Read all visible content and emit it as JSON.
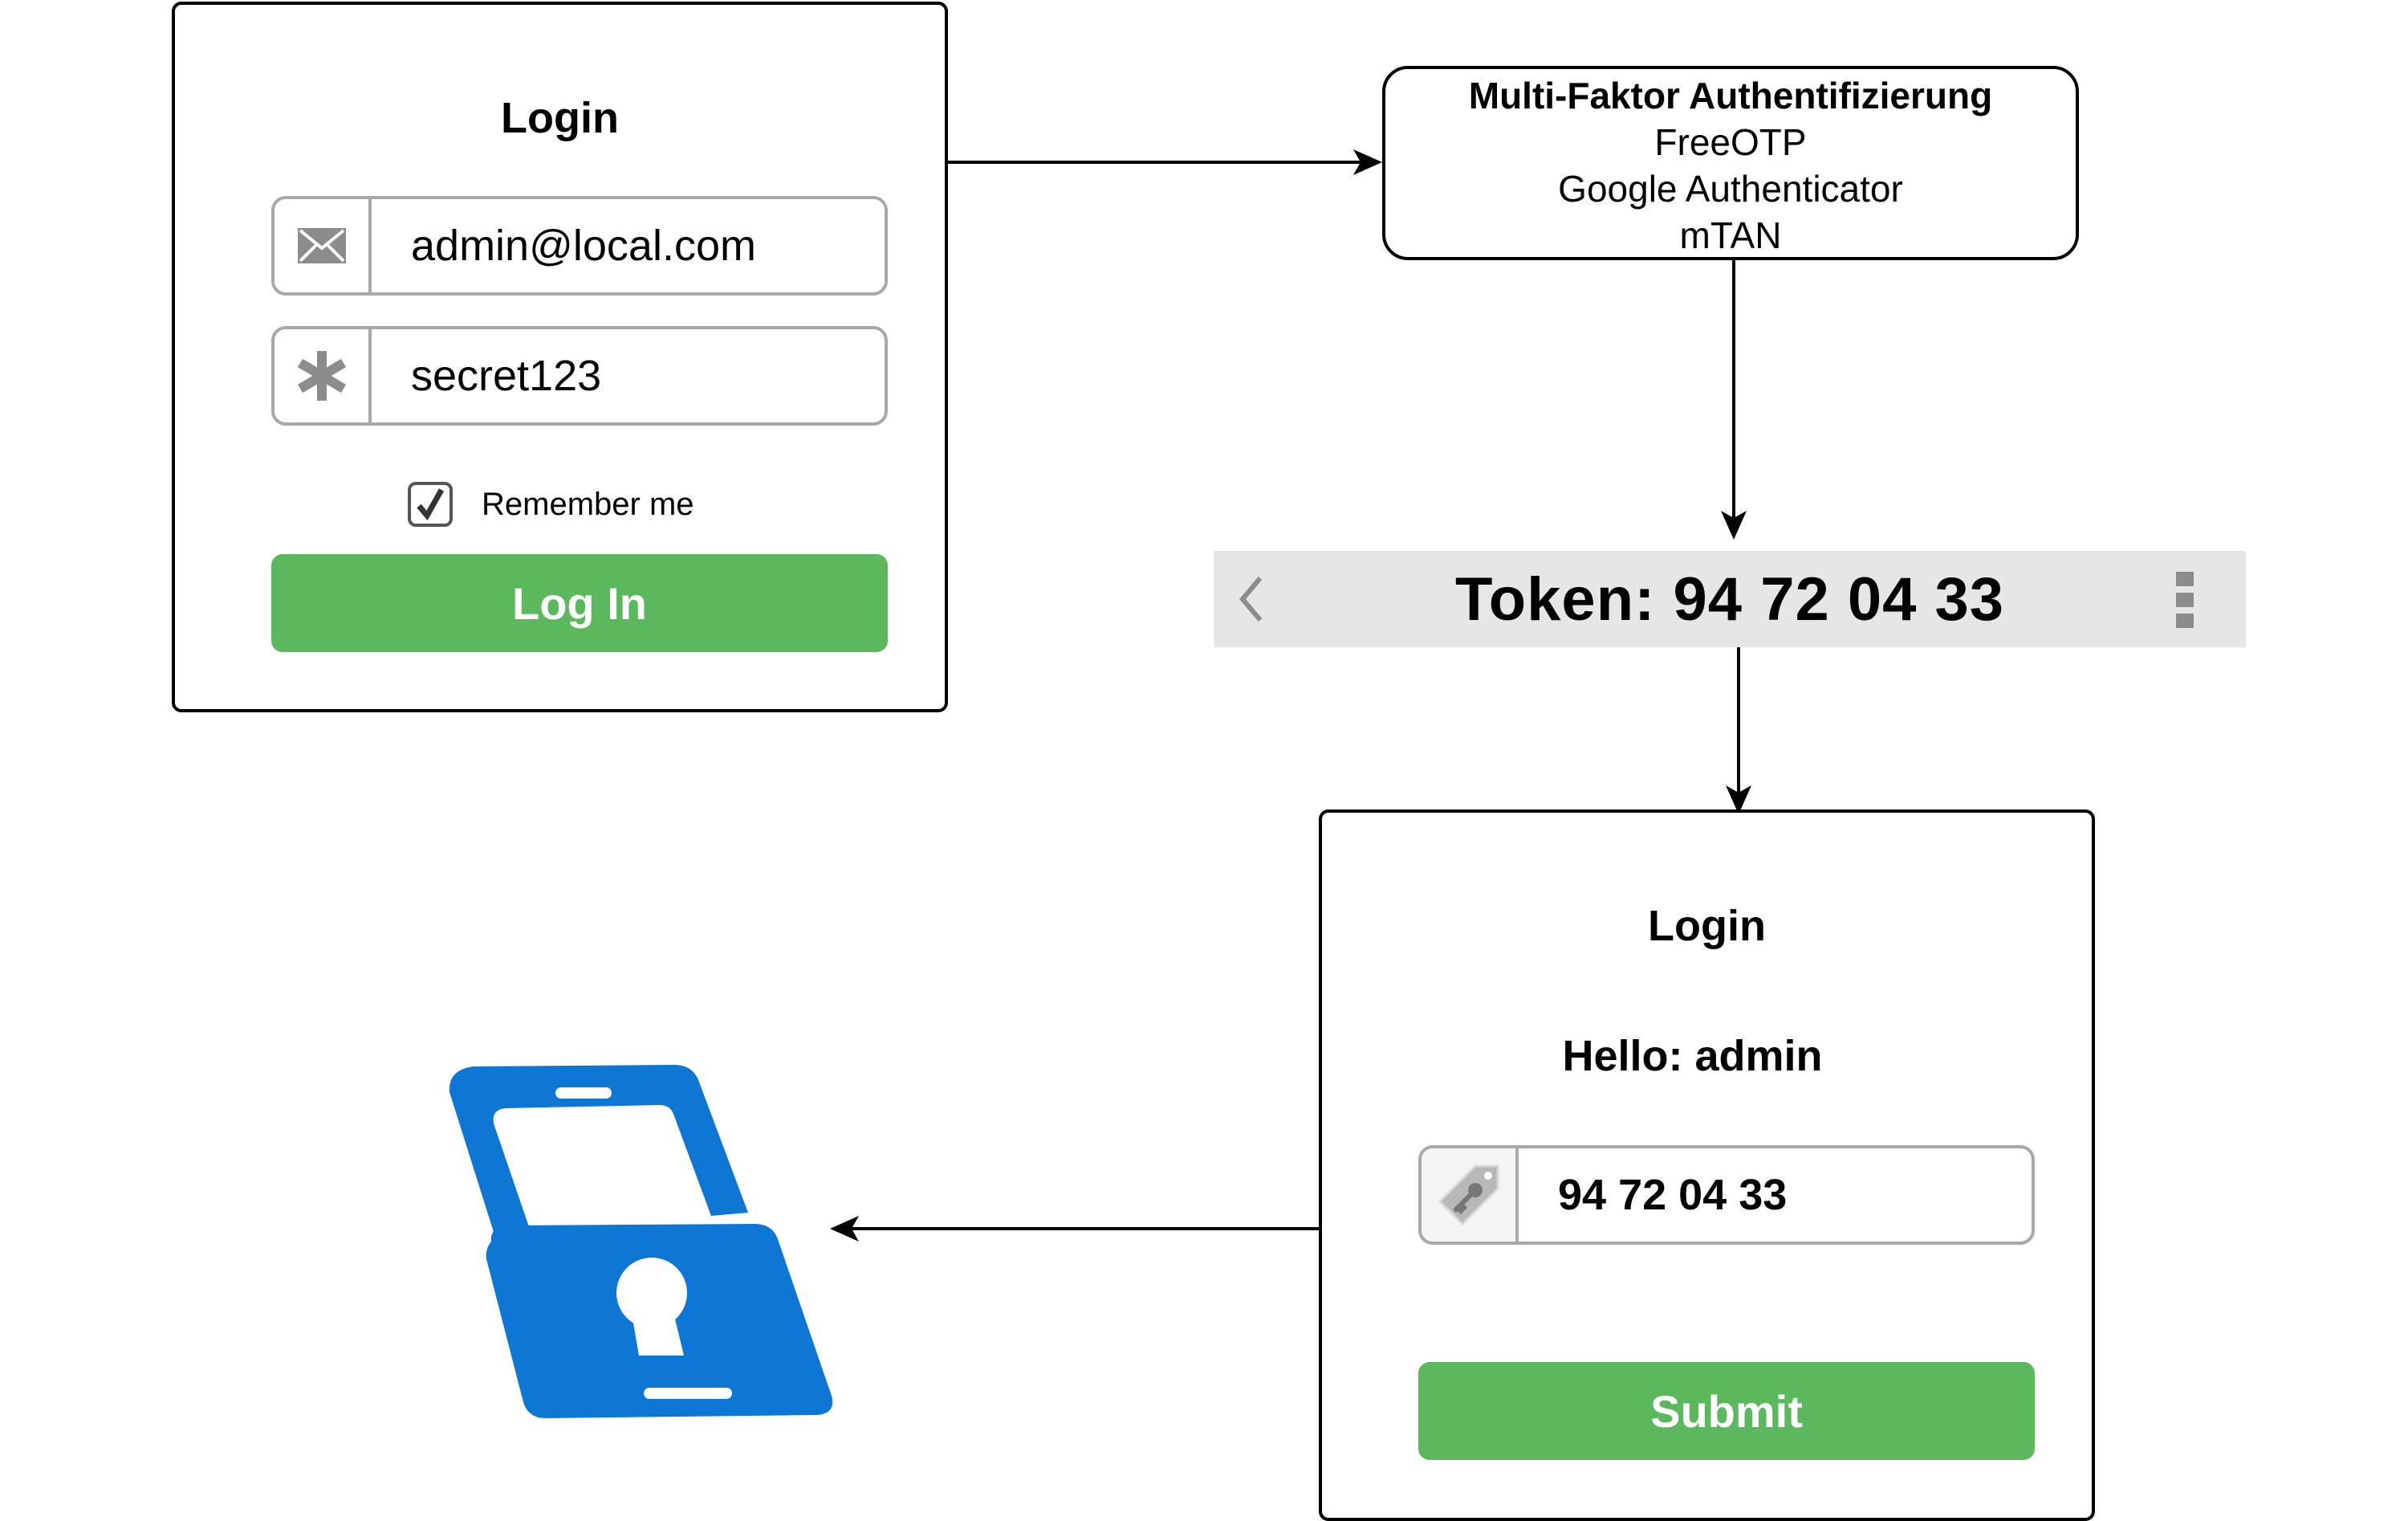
{
  "login_card": {
    "title": "Login",
    "email_value": "admin@local.com",
    "password_value": "secret123",
    "remember_label": "Remember me",
    "remember_checked": true,
    "login_button": "Log In"
  },
  "mfa_box": {
    "title": "Multi-Faktor Authentifizierung",
    "options": [
      "FreeOTP",
      "Google Authenticator",
      "mTAN"
    ]
  },
  "token_bar": {
    "text": "Token: 94 72 04 33"
  },
  "second_login_card": {
    "title": "Login",
    "greeting": "Hello: admin",
    "token_value": "94 72 04 33",
    "submit_button": "Submit"
  },
  "colors": {
    "button_green": "#5cb85c",
    "lock_blue": "#0e77d4",
    "token_bar_bg": "#e6e6e6",
    "field_border": "#a8a8a8"
  },
  "icons": {
    "email": "envelope-icon",
    "password": "asterisk-icon",
    "token": "key-tag-icon",
    "back": "chevron-left-icon",
    "menu": "kebab-menu-icon",
    "unlocked": "open-padlock-icon"
  }
}
